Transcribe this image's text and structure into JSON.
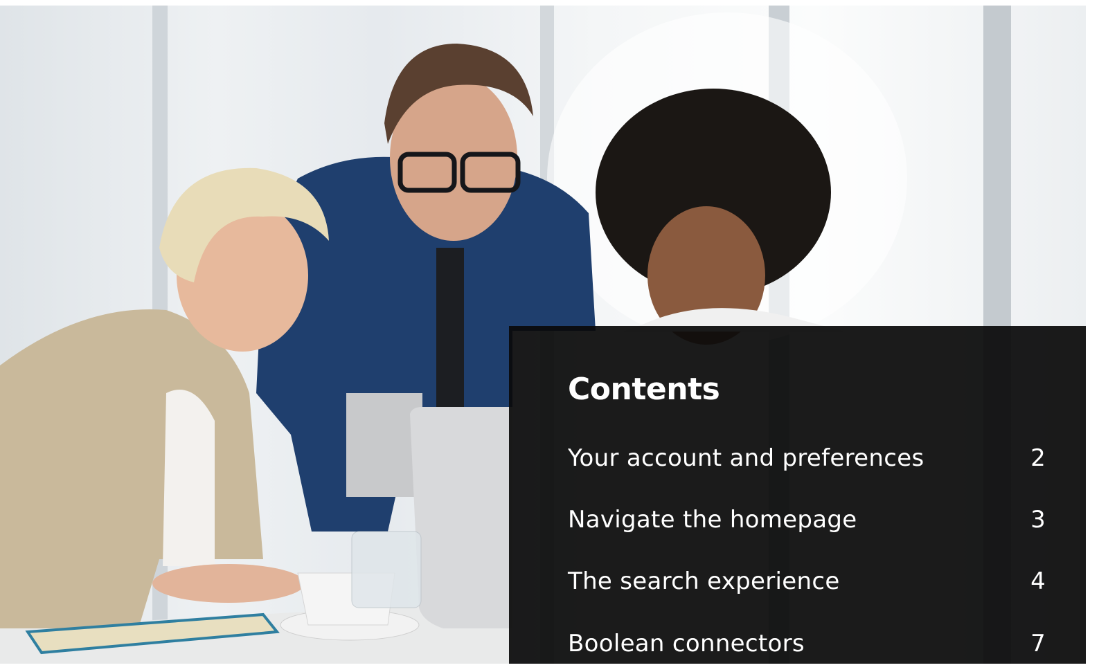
{
  "toc": {
    "title": "Contents",
    "items": [
      {
        "label": "Your account and preferences",
        "page": "2"
      },
      {
        "label": "Navigate the homepage",
        "page": "3"
      },
      {
        "label": "The search experience",
        "page": "4"
      },
      {
        "label": "Boolean connectors",
        "page": "7"
      }
    ]
  },
  "colors": {
    "panel": "#0a0a0a",
    "text": "#ffffff",
    "shirt": "#1f3f6e"
  }
}
